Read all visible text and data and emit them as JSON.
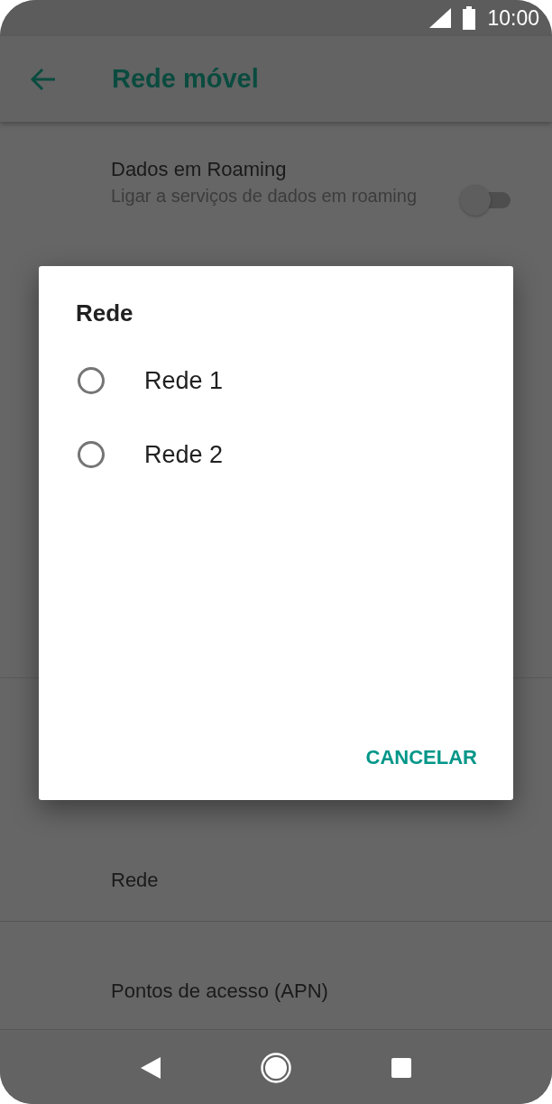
{
  "status_bar": {
    "time": "10:00"
  },
  "app_bar": {
    "title": "Rede móvel"
  },
  "settings": [
    {
      "kind": "switch",
      "title": "Dados em Roaming",
      "summary": "Ligar a serviços de dados em roaming",
      "on": false
    },
    {
      "kind": "plain",
      "title": "Rede"
    },
    {
      "kind": "plain",
      "title": "Pontos de acesso (APN)"
    }
  ],
  "dialog": {
    "title": "Rede",
    "options": [
      {
        "label": "Rede 1",
        "selected": false
      },
      {
        "label": "Rede 2",
        "selected": false
      }
    ],
    "buttons": [
      "CANCELAR"
    ]
  }
}
